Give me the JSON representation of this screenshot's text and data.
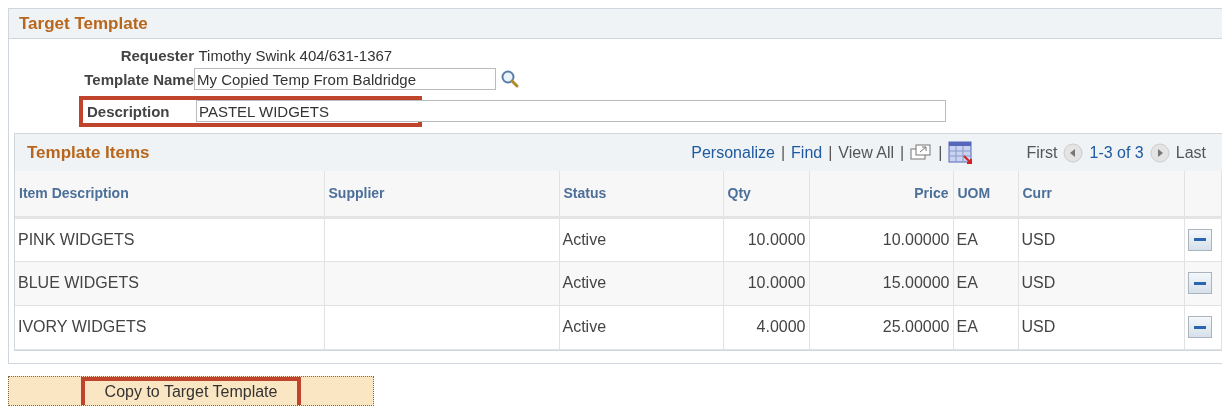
{
  "section_title": "Target Template",
  "requester": {
    "label": "Requester",
    "value": "Timothy Swink 404/631-1367"
  },
  "template_name": {
    "label": "Template Name",
    "value": "My Copied Temp From Baldridge"
  },
  "description": {
    "label": "Description",
    "value": "PASTEL WIDGETS",
    "highlighted": true
  },
  "grid": {
    "title": "Template Items",
    "tools": [
      {
        "kind": "link",
        "label": "Personalize"
      },
      {
        "kind": "separator",
        "label": "|"
      },
      {
        "kind": "link",
        "label": "Find"
      },
      {
        "kind": "separator",
        "label": "|"
      },
      {
        "kind": "text",
        "label": "View All"
      },
      {
        "kind": "separator",
        "label": "|"
      },
      {
        "kind": "zoom"
      },
      {
        "kind": "separator",
        "label": "|"
      },
      {
        "kind": "download"
      }
    ],
    "nav": {
      "first": "First",
      "range": "1-3 of 3",
      "last": "Last"
    },
    "columns": [
      "Item Description",
      "Supplier",
      "Status",
      "Qty",
      "Price",
      "UOM",
      "Curr"
    ],
    "rows": [
      {
        "cells": [
          "PINK WIDGETS",
          "",
          "Active",
          "10.0000",
          "10.00000",
          "EA",
          "USD"
        ]
      },
      {
        "cells": [
          "BLUE WIDGETS",
          "",
          "Active",
          "10.0000",
          "15.00000",
          "EA",
          "USD"
        ]
      },
      {
        "cells": [
          "IVORY WIDGETS",
          "",
          "Active",
          "4.0000",
          "25.00000",
          "EA",
          "USD"
        ]
      }
    ]
  },
  "copy_button": {
    "label": "Copy to Target Template",
    "highlighted": true
  }
}
